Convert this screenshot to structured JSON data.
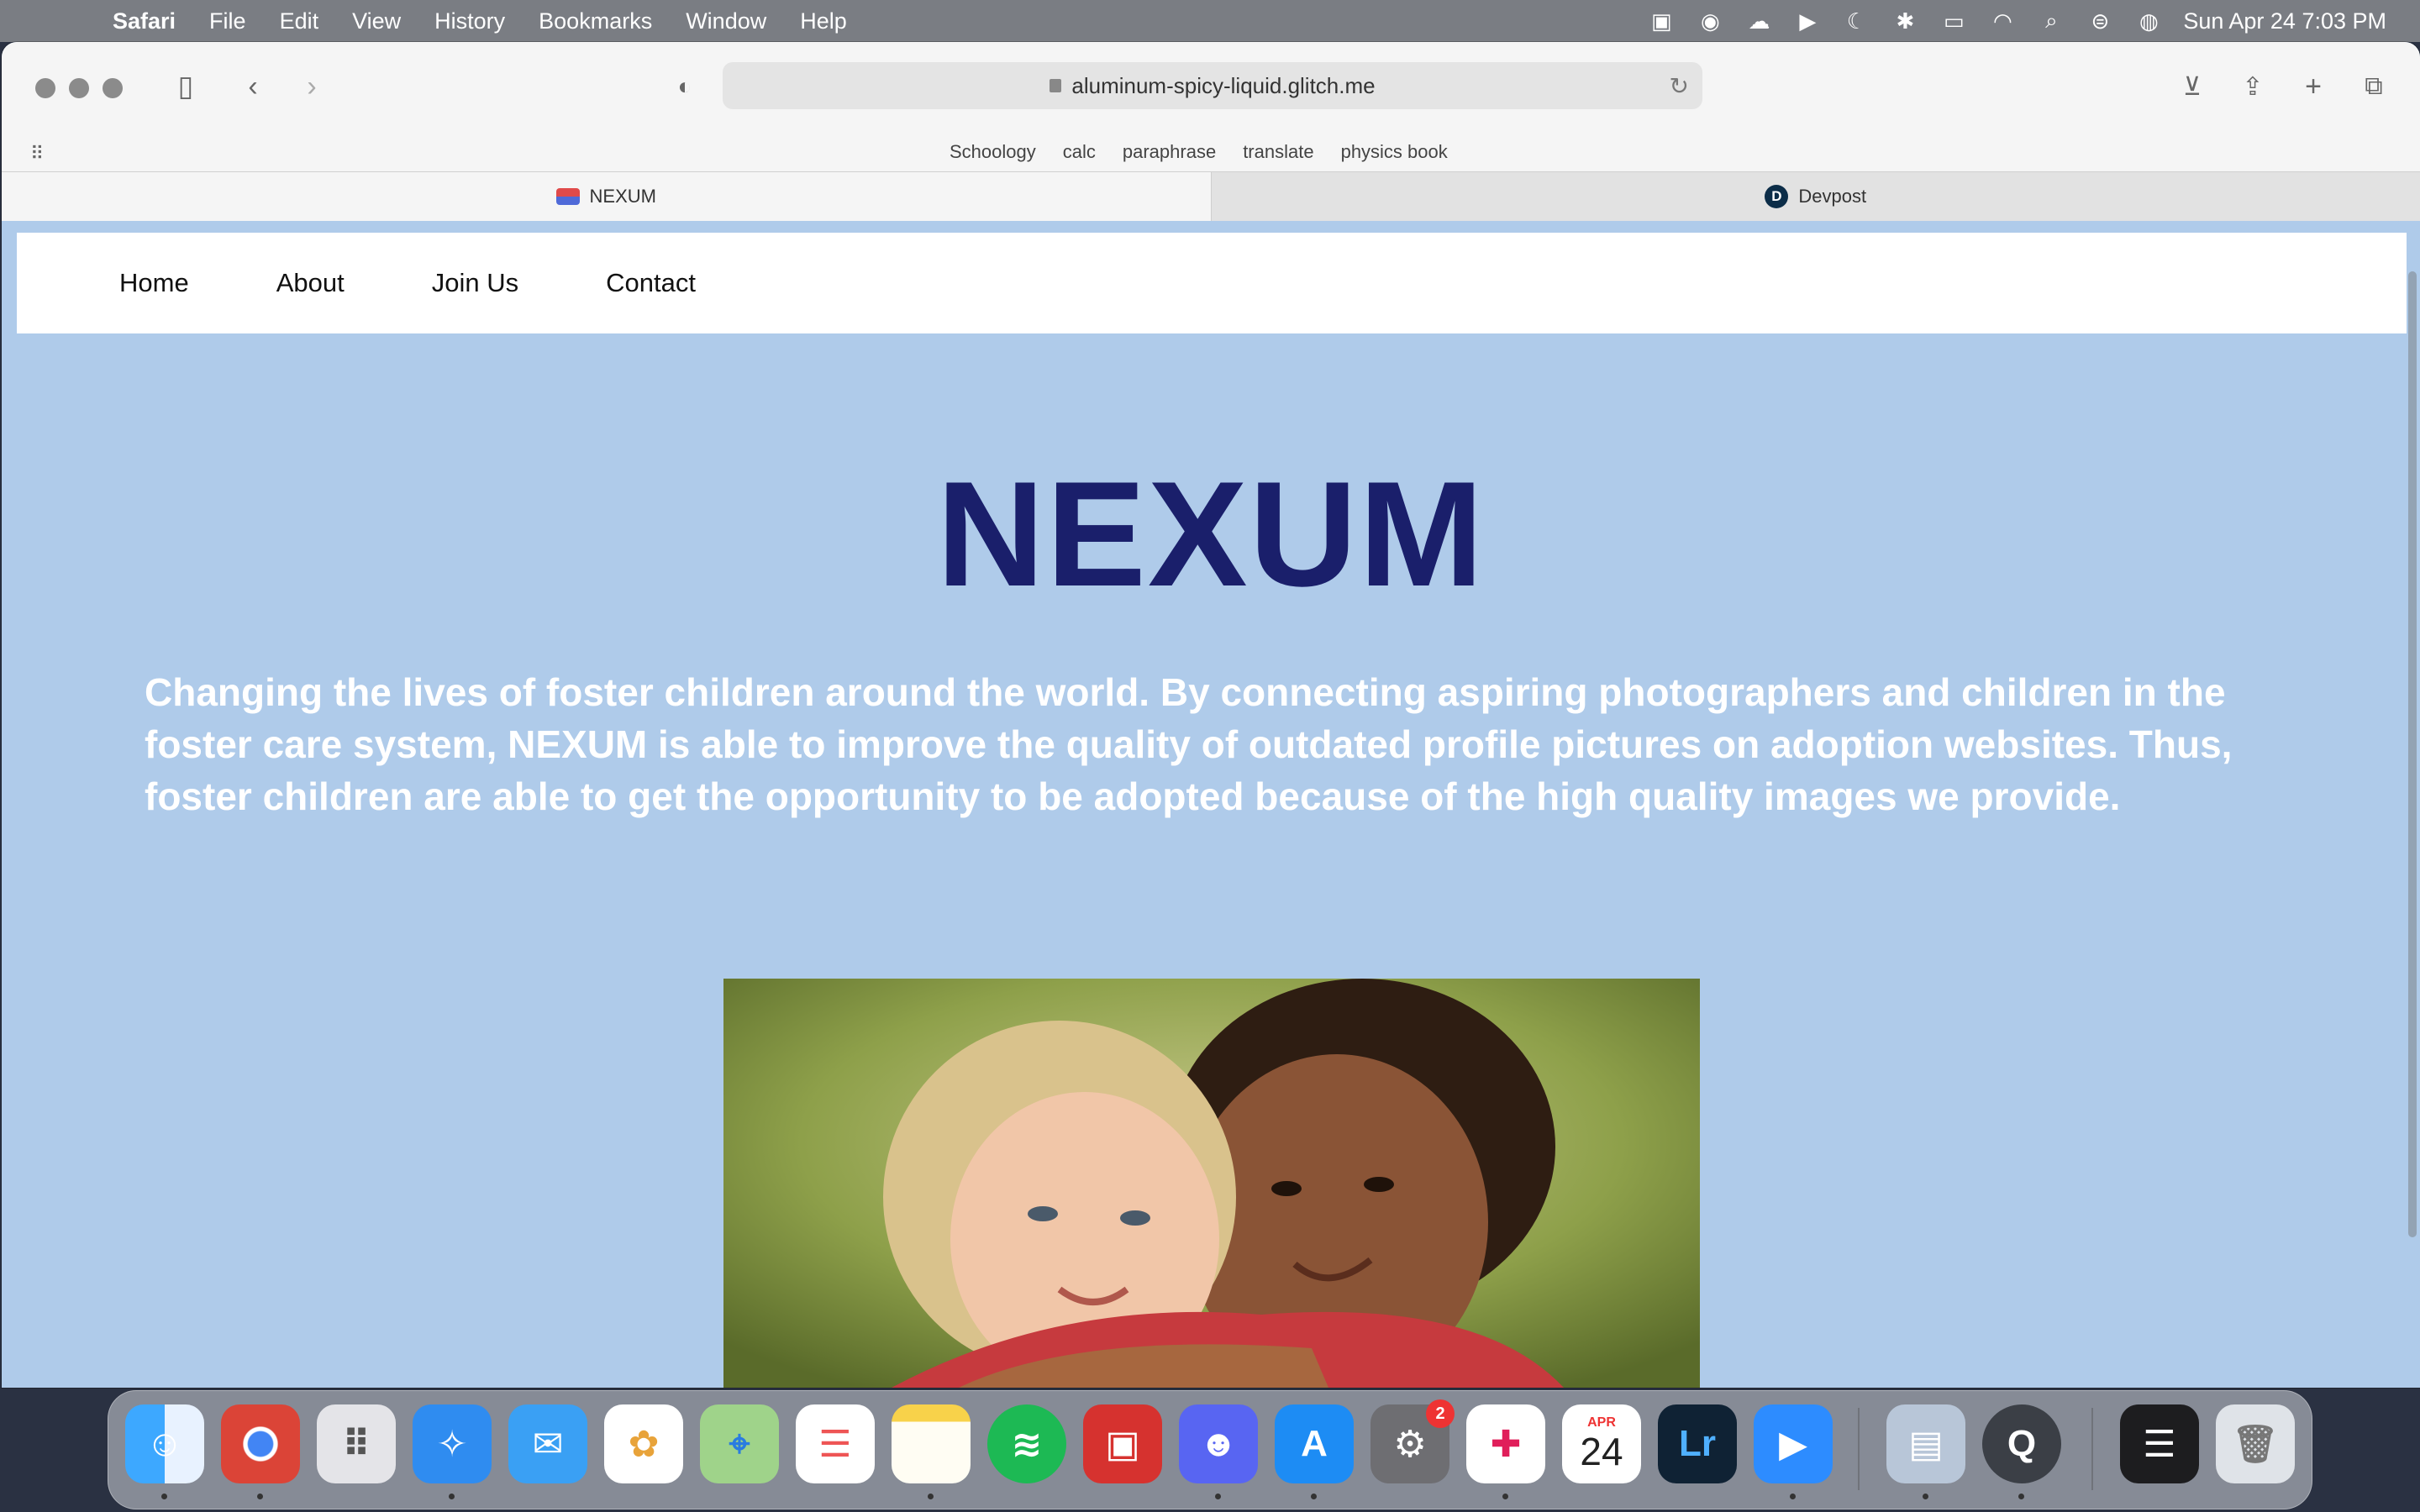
{
  "menubar": {
    "app_name": "Safari",
    "items": [
      "File",
      "Edit",
      "View",
      "History",
      "Bookmarks",
      "Window",
      "Help"
    ],
    "clock": "Sun Apr 24  7:03 PM"
  },
  "browser": {
    "url": "aluminum-spicy-liquid.glitch.me",
    "favorites": [
      "Schoology",
      "calc",
      "paraphrase",
      "translate",
      "physics book"
    ],
    "tabs": [
      {
        "label": "NEXUM",
        "active": true
      },
      {
        "label": "Devpost",
        "active": false
      }
    ]
  },
  "site": {
    "nav": [
      "Home",
      "About",
      "Join Us",
      "Contact"
    ],
    "title": "NEXUM",
    "tagline": "Changing the lives of foster children around the world. By connecting aspiring photographers and children in the foster care system, NEXUM is able to improve the quality of outdated profile pictures on adoption websites. Thus, foster children are able to get the opportunity to be adopted because of the high quality images we provide.",
    "title_color": "#1a1f6b",
    "background_color": "#afcbea"
  },
  "dock": {
    "calendar_month": "APR",
    "calendar_day": "24",
    "lightroom_label": "Lr",
    "system_prefs_badge": "2"
  }
}
